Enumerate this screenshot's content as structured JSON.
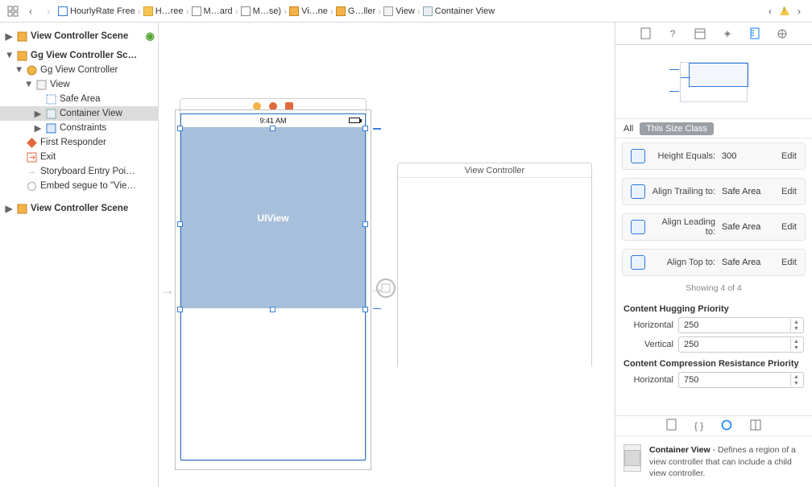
{
  "breadcrumbs": {
    "b0": "HourlyRate Free",
    "b1": "H…ree",
    "b2": "M…ard",
    "b3": "M…se)",
    "b4": "Vi…ne",
    "b5": "G…ller",
    "b6": "View",
    "b7": "Container View"
  },
  "navigator": {
    "scene0": "View Controller Scene",
    "scene1": "Gg View Controller Sc…",
    "vc": "Gg View Controller",
    "view": "View",
    "safe_area": "Safe Area",
    "container_view": "Container View",
    "constraints": "Constraints",
    "first_responder": "First Responder",
    "exit": "Exit",
    "entry": "Storyboard Entry Poi…",
    "embed": "Embed segue to \"Vie…",
    "scene2": "View Controller Scene"
  },
  "canvas": {
    "time": "9:41 AM",
    "uiview_label": "UIView",
    "vc_title": "View Controller"
  },
  "inspector": {
    "seg_all": "All",
    "seg_this": "This Size Class",
    "c0_label": "Height Equals:",
    "c0_val": "300",
    "c1_label": "Align Trailing to:",
    "c1_val": "Safe Area",
    "c2_label": "Align Leading to:",
    "c2_val": "Safe Area",
    "c3_label": "Align Top to:",
    "c3_val": "Safe Area",
    "edit": "Edit",
    "showing": "Showing 4 of 4",
    "hugging_h": "Content Hugging Priority",
    "horiz": "Horizontal",
    "vert": "Vertical",
    "hugging_hv": "250",
    "hugging_vv": "250",
    "comp_h": "Content Compression Resistance Priority",
    "comp_hv": "750",
    "lib_title": "Container View",
    "lib_desc": " - Defines a region of a view controller that can include a child view controller."
  }
}
